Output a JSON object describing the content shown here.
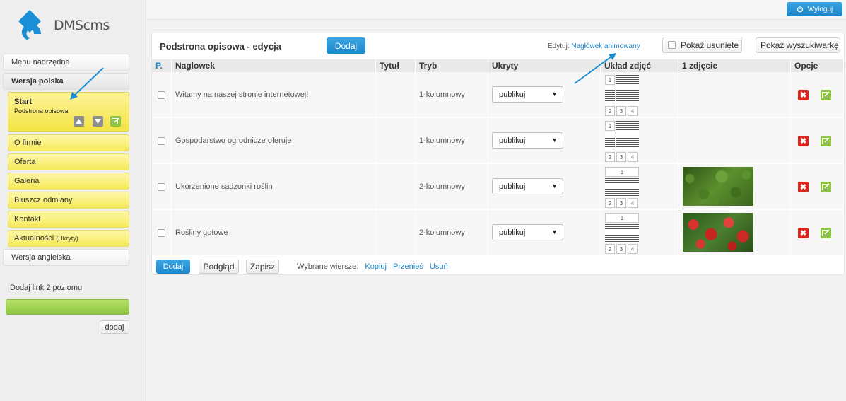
{
  "logo": {
    "text": "DMScms"
  },
  "sidebar": {
    "menu_parent": "Menu nadrzędne",
    "version_pl": "Wersja polska",
    "start": {
      "title": "Start",
      "subtitle": "Podstrona opisowa"
    },
    "items": [
      {
        "label": "O firmie",
        "note": ""
      },
      {
        "label": "Oferta",
        "note": ""
      },
      {
        "label": "Galeria",
        "note": ""
      },
      {
        "label": "Bluszcz odmiany",
        "note": ""
      },
      {
        "label": "Kontakt",
        "note": ""
      },
      {
        "label": "Aktualności",
        "note": "(Ukryty)"
      }
    ],
    "version_en": "Wersja angielska",
    "add_link_label": "Dodaj link 2 poziomu",
    "add_button": "dodaj"
  },
  "topbar": {
    "logout": "Wyloguj"
  },
  "panel": {
    "title": "Podstrona opisowa - edycja",
    "add_button": "Dodaj",
    "edit_prefix": "Edytuj:",
    "edit_link": "Nagłówek animowany",
    "show_deleted": "Pokaż usunięte",
    "show_search": "Pokaż wyszukiwarkę"
  },
  "table": {
    "headers": [
      "P.",
      "Naglowek",
      "Tytuł",
      "Tryb",
      "Ukryty",
      "Układ zdjęć",
      "1 zdjęcie",
      "Opcje"
    ],
    "rows": [
      {
        "naglowek": "Witamy na naszej stronie internetowej!",
        "tytul": "",
        "tryb": "1-kolumnowy",
        "ukryty": "publikuj",
        "layout": "1",
        "photo": ""
      },
      {
        "naglowek": "Gospodarstwo ogrodnicze oferuje",
        "tytul": "",
        "tryb": "1-kolumnowy",
        "ukryty": "publikuj",
        "layout": "1",
        "photo": ""
      },
      {
        "naglowek": "Ukorzenione sadzonki roślin",
        "tytul": "",
        "tryb": "2-kolumnowy",
        "ukryty": "publikuj",
        "layout": "2",
        "photo": "green-leaves"
      },
      {
        "naglowek": "Rośliny gotowe",
        "tytul": "",
        "tryb": "2-kolumnowy",
        "ukryty": "publikuj",
        "layout": "2",
        "photo": "red-anthurium"
      }
    ],
    "layout_labels": {
      "one": "1",
      "two": "2",
      "three": "3",
      "four": "4"
    }
  },
  "footer": {
    "add": "Dodaj",
    "preview": "Podgląd",
    "save": "Zapisz",
    "selected_label": "Wybrane wiersze:",
    "copy": "Kopiuj",
    "move": "Przenieś",
    "delete": "Usuń"
  },
  "colors": {
    "accent_blue": "#1a84c9",
    "menu_yellow": "#f6e95a",
    "green": "#8cc63f",
    "red": "#d9261c"
  }
}
